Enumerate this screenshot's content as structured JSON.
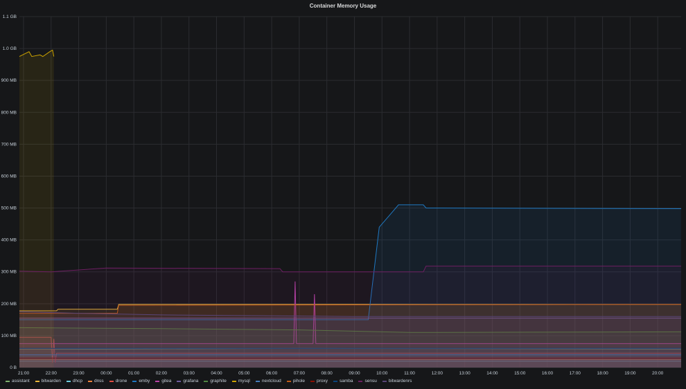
{
  "chart_data": {
    "type": "area",
    "title": "Container Memory Usage",
    "y_ticks": [
      "0 B",
      "100 MB",
      "200 MB",
      "300 MB",
      "400 MB",
      "500 MB",
      "600 MB",
      "700 MB",
      "800 MB",
      "900 MB",
      "1.0 GB",
      "1.1 GB"
    ],
    "ylim": [
      0,
      1100
    ],
    "y_unit": "MB",
    "x_ticks": [
      "21:00",
      "22:00",
      "23:00",
      "00:00",
      "01:00",
      "02:00",
      "03:00",
      "04:00",
      "05:00",
      "06:00",
      "07:00",
      "08:00",
      "09:00",
      "10:00",
      "11:00",
      "12:00",
      "13:00",
      "14:00",
      "15:00",
      "16:00",
      "17:00",
      "18:00",
      "19:00",
      "20:00"
    ],
    "xlim_hours": [
      -0.15,
      23.85
    ],
    "grid": true,
    "legend_position": "bottom",
    "series": [
      {
        "name": "assistant",
        "color": "#7eb26d",
        "points": [
          [
            -0.15,
            58
          ],
          [
            3,
            58
          ],
          [
            10,
            60
          ],
          [
            23.85,
            58
          ]
        ]
      },
      {
        "name": "bitwarden",
        "color": "#eab839",
        "points": [
          [
            -0.15,
            178
          ],
          [
            1.2,
            178
          ],
          [
            1.25,
            183
          ],
          [
            3.4,
            183
          ],
          [
            3.45,
            198
          ],
          [
            23.85,
            198
          ]
        ]
      },
      {
        "name": "dhcp",
        "color": "#6ed0e0",
        "points": [
          [
            -0.15,
            20
          ],
          [
            23.85,
            20
          ]
        ]
      },
      {
        "name": "dnss",
        "color": "#ef843c",
        "points": [
          [
            -0.15,
            25
          ],
          [
            23.85,
            25
          ]
        ]
      },
      {
        "name": "drone",
        "color": "#e24d42",
        "points": [
          [
            -0.15,
            95
          ],
          [
            1.0,
            95
          ],
          [
            1.05,
            15
          ],
          [
            1.1,
            90
          ],
          [
            1.15,
            15
          ],
          [
            1.2,
            45
          ],
          [
            23.85,
            45
          ]
        ]
      },
      {
        "name": "emby",
        "color": "#1f78c1",
        "points": [
          [
            -0.15,
            150
          ],
          [
            12.5,
            150
          ],
          [
            12.9,
            440
          ],
          [
            13.3,
            480
          ],
          [
            13.6,
            510
          ],
          [
            14.5,
            510
          ],
          [
            14.6,
            500
          ],
          [
            23.85,
            498
          ]
        ]
      },
      {
        "name": "gitea",
        "color": "#ba43a9",
        "points": [
          [
            -0.15,
            75
          ],
          [
            9.8,
            75
          ],
          [
            9.85,
            270
          ],
          [
            9.9,
            75
          ],
          [
            10.5,
            75
          ],
          [
            10.55,
            230
          ],
          [
            10.6,
            75
          ],
          [
            23.85,
            75
          ]
        ]
      },
      {
        "name": "grafana",
        "color": "#705da0",
        "points": [
          [
            -0.15,
            155
          ],
          [
            23.85,
            155
          ]
        ]
      },
      {
        "name": "graphite",
        "color": "#508642",
        "points": [
          [
            -0.15,
            125
          ],
          [
            5,
            122
          ],
          [
            10,
            118
          ],
          [
            14,
            110
          ],
          [
            23.85,
            112
          ]
        ]
      },
      {
        "name": "mysql",
        "color": "#cca300",
        "points": [
          [
            -0.15,
            975
          ],
          [
            0.2,
            990
          ],
          [
            0.3,
            975
          ],
          [
            0.6,
            980
          ],
          [
            0.7,
            975
          ],
          [
            0.95,
            990
          ],
          [
            1.05,
            995
          ],
          [
            1.1,
            975
          ]
        ]
      },
      {
        "name": "nextcloud",
        "color": "#447ebc",
        "points": [
          [
            -0.15,
            40
          ],
          [
            23.85,
            40
          ]
        ]
      },
      {
        "name": "pihole",
        "color": "#c15c17",
        "points": [
          [
            -0.15,
            170
          ],
          [
            3.4,
            170
          ],
          [
            3.45,
            195
          ],
          [
            23.85,
            198
          ]
        ]
      },
      {
        "name": "proxy",
        "color": "#890f02",
        "points": [
          [
            -0.15,
            30
          ],
          [
            23.85,
            30
          ]
        ]
      },
      {
        "name": "samba",
        "color": "#0a437c",
        "points": [
          [
            -0.15,
            60
          ],
          [
            23.85,
            60
          ]
        ]
      },
      {
        "name": "sensu",
        "color": "#6d1f62",
        "points": [
          [
            -0.15,
            302
          ],
          [
            1.0,
            300
          ],
          [
            3.0,
            312
          ],
          [
            9.3,
            310
          ],
          [
            9.4,
            300
          ],
          [
            14.5,
            300
          ],
          [
            14.6,
            318
          ],
          [
            23.85,
            318
          ]
        ]
      },
      {
        "name": "bitwardenrs",
        "color": "#584477",
        "points": [
          [
            -0.15,
            175
          ],
          [
            2.0,
            170
          ],
          [
            5,
            165
          ],
          [
            12,
            160
          ],
          [
            23.85,
            160
          ]
        ]
      }
    ]
  }
}
